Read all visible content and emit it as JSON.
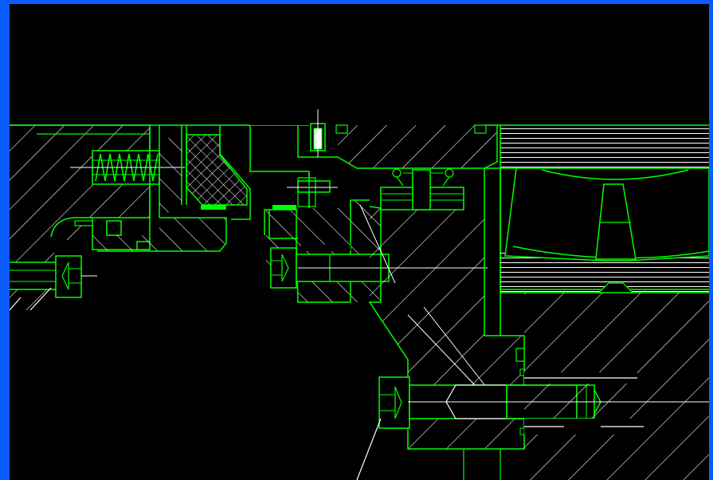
{
  "viewer": {
    "frame_color": "#0a5cff",
    "background_color": "#000000",
    "outline_color": "#00ff00",
    "hatch_color": "#ffffff"
  },
  "drawing": {
    "kind": "mechanical-section-view",
    "components": [
      "bolt-head-left",
      "spring-coil",
      "packing-crosshatch",
      "socket-screw-mid",
      "socket-screw-bottom",
      "bearing-roller",
      "thrust-pad-stack-upper",
      "thrust-pad-stack-lower",
      "o-ring-seal"
    ]
  }
}
